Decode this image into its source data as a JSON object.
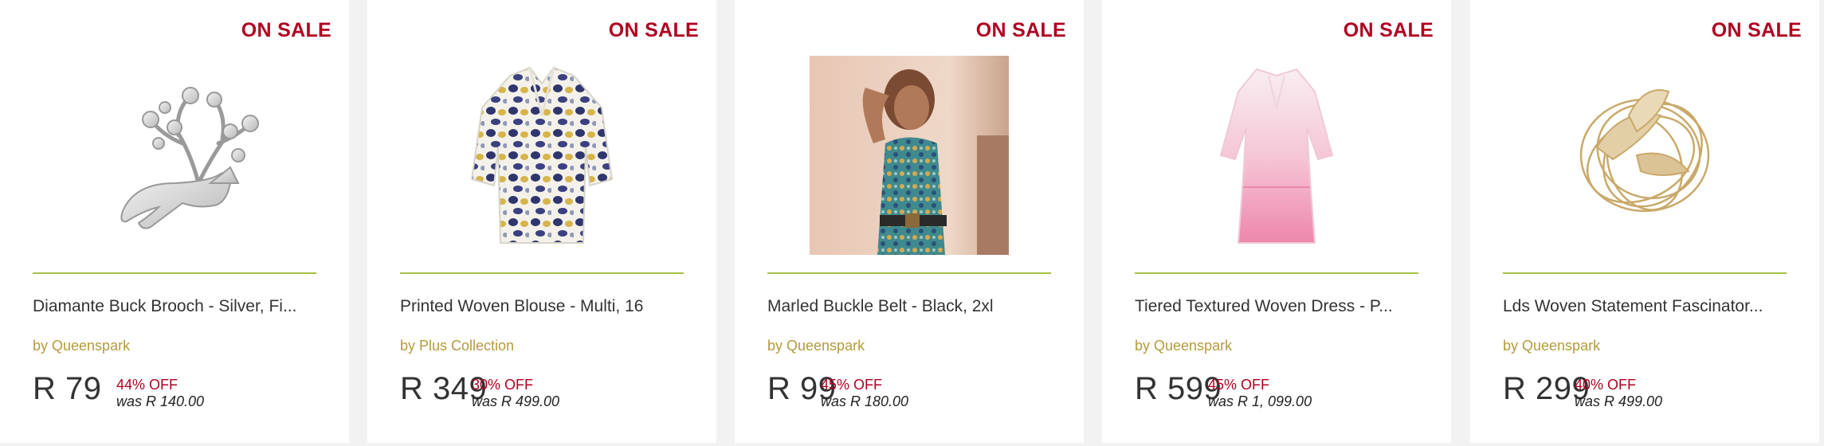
{
  "products": [
    {
      "badge": "ON SALE",
      "title": "Diamante Buck Brooch - Silver, Fi...",
      "brand": "by Queenspark",
      "price": "R 79",
      "discount": "44% OFF",
      "was": "was R 140.00",
      "image_icon": "brooch-icon"
    },
    {
      "badge": "ON SALE",
      "title": "Printed Woven Blouse - Multi, 16",
      "brand": "by Plus Collection",
      "price": "R 349",
      "discount": "30% OFF",
      "was": "was R 499.00",
      "image_icon": "blouse-icon"
    },
    {
      "badge": "ON SALE",
      "title": "Marled Buckle Belt - Black, 2xl",
      "brand": "by Queenspark",
      "price": "R 99",
      "discount": "45% OFF",
      "was": "was R 180.00",
      "image_icon": "model-photo"
    },
    {
      "badge": "ON SALE",
      "title": "Tiered Textured Woven Dress - P...",
      "brand": "by Queenspark",
      "price": "R 599",
      "discount": "45% OFF",
      "was": "was R 1, 099.00",
      "image_icon": "dress-icon"
    },
    {
      "badge": "ON SALE",
      "title": "Lds Woven Statement Fascinator...",
      "brand": "by Queenspark",
      "price": "R 299",
      "discount": "40% OFF",
      "was": "was R 499.00",
      "image_icon": "fascinator-icon"
    }
  ],
  "colors": {
    "sale_red": "#b00020",
    "brand_gold": "#b59a3c",
    "divider_green": "#a3c14a"
  }
}
